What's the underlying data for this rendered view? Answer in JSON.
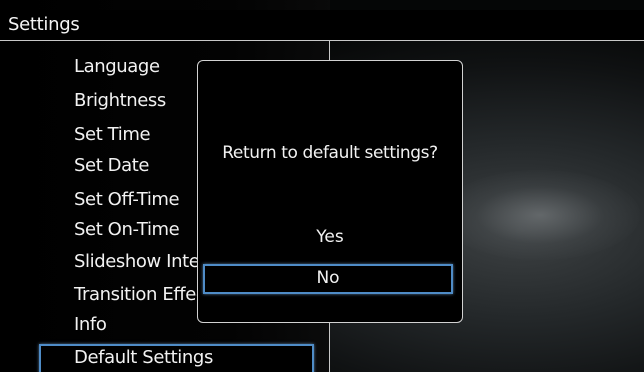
{
  "header": {
    "title": "Settings"
  },
  "menu": {
    "items": [
      {
        "label": "Language"
      },
      {
        "label": "Brightness"
      },
      {
        "label": "Set Time"
      },
      {
        "label": "Set Date"
      },
      {
        "label": "Set Off-Time"
      },
      {
        "label": "Set On-Time"
      },
      {
        "label": "Slideshow Interval"
      },
      {
        "label": "Transition Effect"
      },
      {
        "label": "Info"
      },
      {
        "label": "Default Settings",
        "selected": true
      }
    ]
  },
  "dialog": {
    "message": "Return to default settings?",
    "options": [
      {
        "label": "Yes"
      },
      {
        "label": "No",
        "selected": true
      }
    ]
  },
  "colors": {
    "highlight": "#4f8cc7",
    "background": "#000000",
    "text": "#f2f2f2",
    "border": "#d2d2d2"
  }
}
